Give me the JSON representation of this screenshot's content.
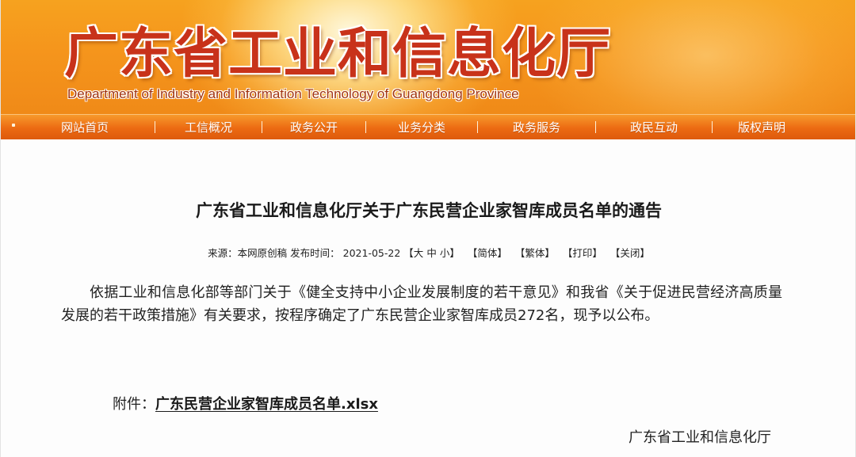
{
  "header": {
    "site_title": "广东省工业和信息化厅",
    "site_subtitle": "Department of Industry and Information Technology of Guangdong Province"
  },
  "nav": {
    "items": [
      {
        "label": "网站首页"
      },
      {
        "label": "工信概况"
      },
      {
        "label": "政务公开"
      },
      {
        "label": "业务分类"
      },
      {
        "label": "政务服务"
      },
      {
        "label": "政民互动"
      },
      {
        "label": "版权声明"
      }
    ]
  },
  "article": {
    "title": "广东省工业和信息化厅关于广东民营企业家智库成员名单的通告",
    "meta": {
      "source_label": "来源：",
      "source_value": "本网原创稿",
      "publish_label": "发布时间：",
      "publish_date": "2021-05-22",
      "font_open": "【大",
      "font_mid": "中",
      "font_close": "小】",
      "simplified": "【简体】",
      "traditional": "【繁体】",
      "print": "【打印】",
      "close": "【关闭】"
    },
    "body": "依据工业和信息化部等部门关于《健全支持中小企业发展制度的若干意见》和我省《关于促进民营经济高质量发展的若干政策措施》有关要求，按程序确定了广东民营企业家智库成员272名，现予以公布。",
    "attachment_label": "附件：",
    "attachment_link": "广东民营企业家智库成员名单.xlsx",
    "signature": "广东省工业和信息化厅"
  },
  "colors": {
    "banner_orange": "#f5951c",
    "nav_orange": "#ec6a12",
    "title_red": "#c8321a"
  }
}
